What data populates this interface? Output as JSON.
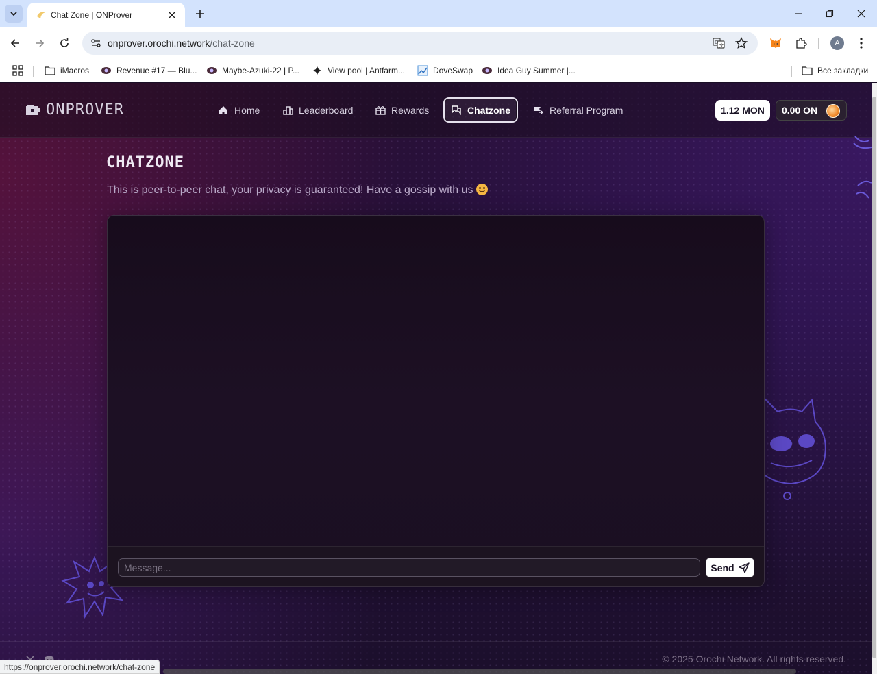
{
  "browser": {
    "tab_title": "Chat Zone | ONProver",
    "url_host": "onprover.orochi.network",
    "url_path": "/chat-zone",
    "bookmarks": [
      {
        "label": "iMacros",
        "icon": "folder-icon"
      },
      {
        "label": "Revenue #17 — Blu...",
        "icon": "eye-avatar-icon"
      },
      {
        "label": "Maybe-Azuki-22 | P...",
        "icon": "eye-avatar-icon"
      },
      {
        "label": "View pool | Antfarm...",
        "icon": "diamond-icon"
      },
      {
        "label": "DoveSwap",
        "icon": "chart-icon"
      },
      {
        "label": "Idea Guy Summer |...",
        "icon": "eye-avatar-icon"
      }
    ],
    "all_bookmarks": "Все закладки",
    "avatar_letter": "A",
    "status_url": "https://onprover.orochi.network/chat-zone"
  },
  "site": {
    "logo": "ONPROVER",
    "nav": [
      {
        "label": "Home",
        "icon": "home-icon",
        "active": false
      },
      {
        "label": "Leaderboard",
        "icon": "leaderboard-icon",
        "active": false
      },
      {
        "label": "Rewards",
        "icon": "rewards-icon",
        "active": false
      },
      {
        "label": "Chatzone",
        "icon": "chat-icon",
        "active": true
      },
      {
        "label": "Referral Program",
        "icon": "referral-icon",
        "active": false
      }
    ],
    "balance_mon": "1.12 MON",
    "balance_on": "0.00 ON"
  },
  "chat": {
    "title": "CHATZONE",
    "subtitle": "This is peer-to-peer chat, your privacy is guaranteed! Have a gossip with us",
    "messages": [],
    "input_placeholder": "Message...",
    "send_label": "Send"
  },
  "footer": {
    "copyright": "© 2025 Orochi Network. All rights reserved."
  },
  "colors": {
    "accent": "#ffffff",
    "background": "#1a0f26",
    "text_muted": "#b9a9c8"
  }
}
